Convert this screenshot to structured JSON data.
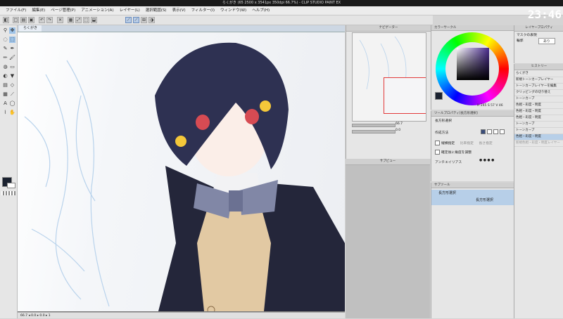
{
  "window": {
    "title": "らくがき (65 2500 x 3541px 350dpi 66.7%) - CLIP STUDIO PAINT EX"
  },
  "clock": "23:46",
  "menu": [
    "ファイル(F)",
    "編集(E)",
    "ページ管理(P)",
    "アニメーション(A)",
    "レイヤー(L)",
    "選択範囲(S)",
    "表示(V)",
    "フィルター(I)",
    "ウィンドウ(W)",
    "ヘルプ(H)"
  ],
  "canvas": {
    "tab": "らくがき",
    "status": "66.7  ◂ 0.0  ▸  0.0  ▸  1"
  },
  "navigator": {
    "title": "ナビゲーター",
    "zoom": "66.7",
    "angle": "0.0"
  },
  "preview": {
    "title": "サブビュー"
  },
  "color": {
    "title": "カラーサークル",
    "h_label": "H",
    "h": "245",
    "s_label": "S",
    "s": "57",
    "v_label": "V",
    "v": "46",
    "accent": "#4a2b8f"
  },
  "toolprop": {
    "title": "ツールプロパティ[長方形選択]",
    "tool_name": "長方形選択",
    "mode_label": "作成方法",
    "opt1": "縦横指定",
    "opt1b": "比率指定",
    "opt1c": "長さ指定",
    "opt2": "確定後に角度を調整",
    "aa_label": "アンチエイリアス"
  },
  "subtool": {
    "title": "サブツール",
    "items": [
      "長方形選択",
      "長方形選択"
    ]
  },
  "layerprop": {
    "title": "レイヤープロパティ",
    "label": "マスクの表現",
    "value": "輪郭",
    "value2": "あり"
  },
  "history": {
    "title": "ヒストリー",
    "items": [
      "らくがき",
      "新規トーンカーブレイヤー",
      "トーンカーブレイヤーを編集",
      "クリッピングの切り替え",
      "トーンカーブ",
      "色相・彩度・明度",
      "色相・彩度・明度",
      "色相・彩度・明度",
      "トーンカーブ",
      "トーンカーブ",
      "色相・彩度・明度",
      "新規色相・彩度・明度レイヤー"
    ]
  }
}
